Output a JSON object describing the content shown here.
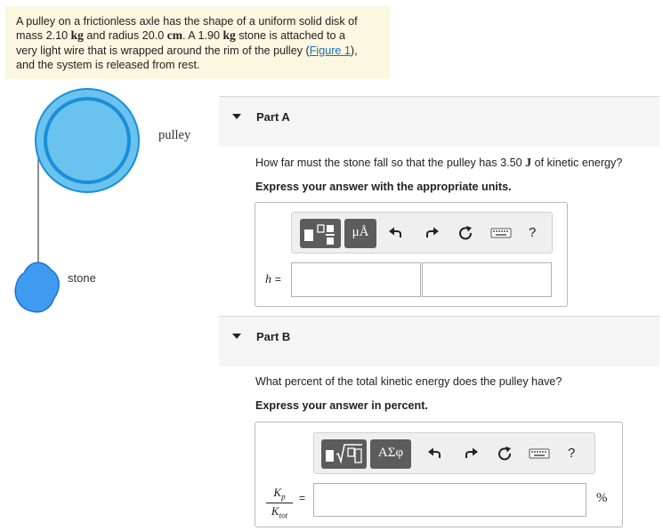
{
  "problem": {
    "t1": "A pulley on a frictionless axle has the shape of a uniform solid disk of",
    "t2a": "mass 2.10 ",
    "t2u1": "kg",
    "t2b": " and radius 20.0 ",
    "t2u2": "cm",
    "t2c": ". A 1.90 ",
    "t2u3": "kg",
    "t2d": " stone is attached to a",
    "t3a": "very light wire that is wrapped around the rim of the pulley (",
    "t3link": "Figure 1",
    "t3b": "),",
    "t4": "and the system is released from rest."
  },
  "figure": {
    "pulley_label": "pulley",
    "stone_label": "stone",
    "colors": {
      "disk": "#6ac3ef",
      "rim": "#1a8ed8",
      "stone_fill": "#3e9bf0",
      "stone_edge": "#1d71d0",
      "wire": "#555555"
    }
  },
  "partA": {
    "title": "Part A",
    "question_a": "How far must the stone fall so that the pulley has 3.50 ",
    "question_unit": "J",
    "question_b": " of kinetic energy?",
    "instruction": "Express your answer with the appropriate units.",
    "toolbar": {
      "units_label": "μÅ",
      "help_label": "?"
    },
    "answer_var": "h",
    "equals": "=",
    "value_field": "",
    "units_field": ""
  },
  "partB": {
    "title": "Part B",
    "question": "What percent of the total kinetic energy does the pulley have?",
    "instruction": "Express your answer in percent.",
    "toolbar": {
      "symbols_label": "ΑΣφ",
      "help_label": "?"
    },
    "frac_num": "K",
    "frac_num_sub": "p",
    "frac_den": "K",
    "frac_den_sub": "tot",
    "equals": "=",
    "value_field": "",
    "unit": "%"
  },
  "colors": {
    "problem_bg": "#fbf7e1",
    "link": "#1a6fb5",
    "tool_button": "#5c5c5c",
    "part_header_bg": "#f5f5f5"
  }
}
